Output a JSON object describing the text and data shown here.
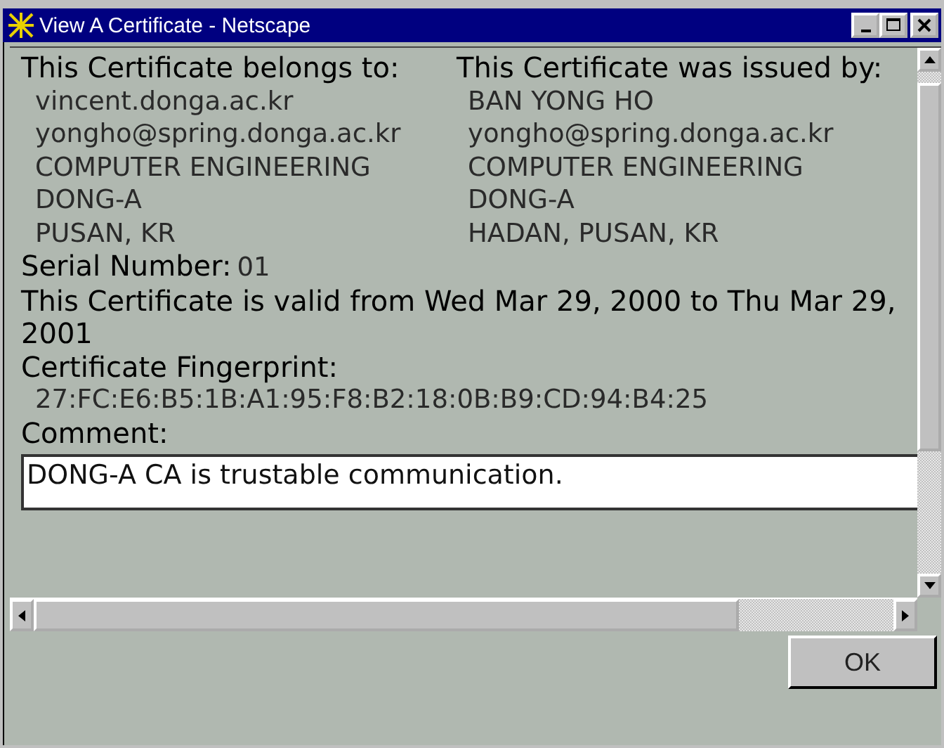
{
  "window": {
    "title": "View A Certificate - Netscape"
  },
  "owner": {
    "heading": "This Certificate belongs to:",
    "lines": [
      "vincent.donga.ac.kr",
      "yongho@spring.donga.ac.kr",
      "COMPUTER ENGINEERING",
      "DONG-A",
      "PUSAN, KR"
    ]
  },
  "issuer": {
    "heading": "This Certificate was issued by:",
    "lines": [
      "BAN YONG HO",
      "yongho@spring.donga.ac.kr",
      "COMPUTER ENGINEERING",
      "DONG-A",
      "HADAN, PUSAN, KR"
    ]
  },
  "serial": {
    "label": "Serial Number:",
    "value": "01"
  },
  "validity": "This Certificate is valid from Wed Mar 29, 2000 to Thu Mar 29, 2001",
  "fingerprint": {
    "label": "Certificate Fingerprint:",
    "value": "27:FC:E6:B5:1B:A1:95:F8:B2:18:0B:B9:CD:94:B4:25"
  },
  "comment": {
    "label": "Comment:",
    "value": "DONG-A CA is trustable communication."
  },
  "buttons": [
    "OK"
  ]
}
